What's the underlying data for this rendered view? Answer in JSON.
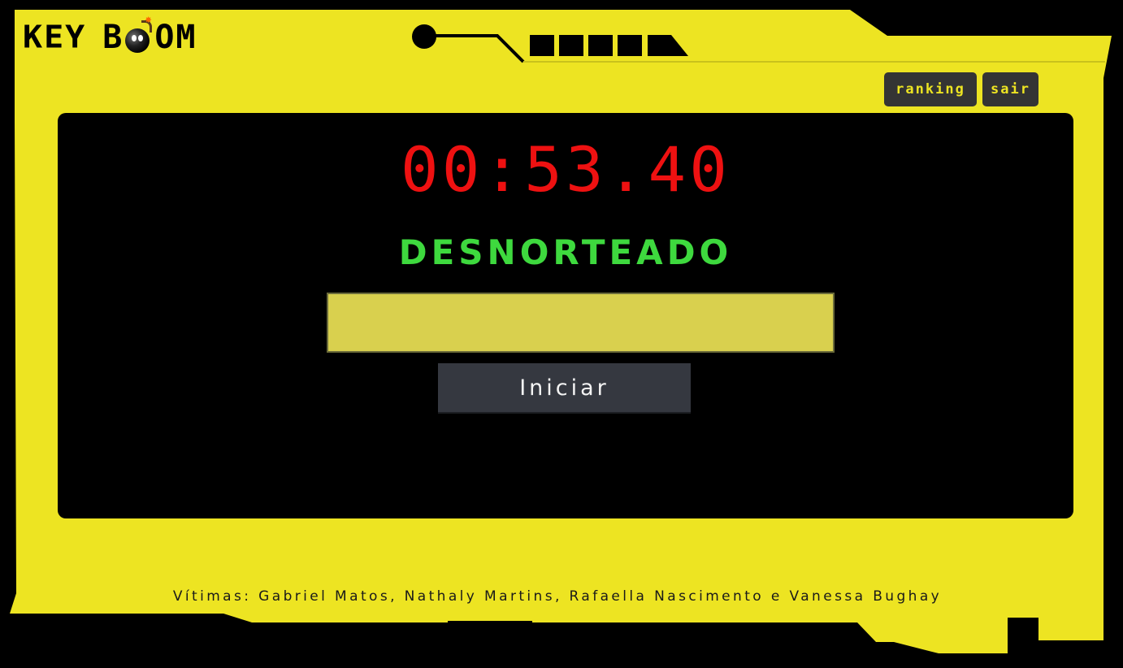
{
  "header": {
    "logo_word1": "KEY",
    "logo_word2_start": "B",
    "logo_word2_end": "OM",
    "nav": {
      "ranking_label": "ranking",
      "sair_label": "sair"
    }
  },
  "game": {
    "timer": "00:53.40",
    "status": "DESNORTEADO",
    "answer_value": "",
    "start_label": "Iniciar"
  },
  "footer": {
    "credits": "Vítimas: Gabriel Matos, Nathaly Martins, Rafaella Nascimento e Vanessa Bughay"
  },
  "colors": {
    "frame_yellow": "#ede422",
    "timer_red": "#ee1111",
    "status_green": "#3ed93e",
    "input_yellow": "#d9d04e",
    "button_dark": "#353840"
  },
  "icons": {
    "logo_bomb": "bomb-icon"
  }
}
